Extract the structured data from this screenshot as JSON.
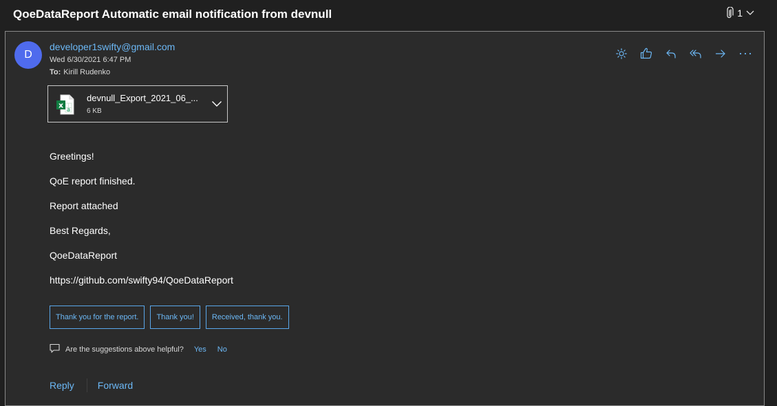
{
  "header": {
    "subject": "QoeDataReport Automatic email notification from devnull",
    "attachment_count": "1",
    "icons": [
      "paperclip-icon",
      "chevron-down-icon"
    ]
  },
  "message": {
    "avatar_initial": "D",
    "avatar_color": "#4f6bed",
    "sender": "developer1swifty@gmail.com",
    "date": "Wed 6/30/2021 6:47 PM",
    "to_label": "To:",
    "to_name": "Kirill Rudenko",
    "action_icons": [
      "sun-icon",
      "like-icon",
      "reply-icon",
      "reply-all-icon",
      "forward-icon",
      "more-icon"
    ]
  },
  "attachment": {
    "name": "devnull_Export_2021_06_...",
    "size": "6 KB",
    "icon": "excel-file-icon"
  },
  "body": {
    "lines": [
      "Greetings!",
      "QoE report finished.",
      "Report attached",
      "Best Regards,",
      "QoeDataReport",
      "https://github.com/swifty94/QoeDataReport"
    ]
  },
  "suggestions": {
    "replies": [
      "Thank you for the report.",
      "Thank you!",
      "Received, thank you."
    ],
    "helpful_question": "Are the suggestions above helpful?",
    "yes": "Yes",
    "no": "No"
  },
  "footer": {
    "reply": "Reply",
    "forward": "Forward"
  },
  "colors": {
    "background": "#202020",
    "panel": "#2b2b2b",
    "accent": "#6cb8f6"
  }
}
